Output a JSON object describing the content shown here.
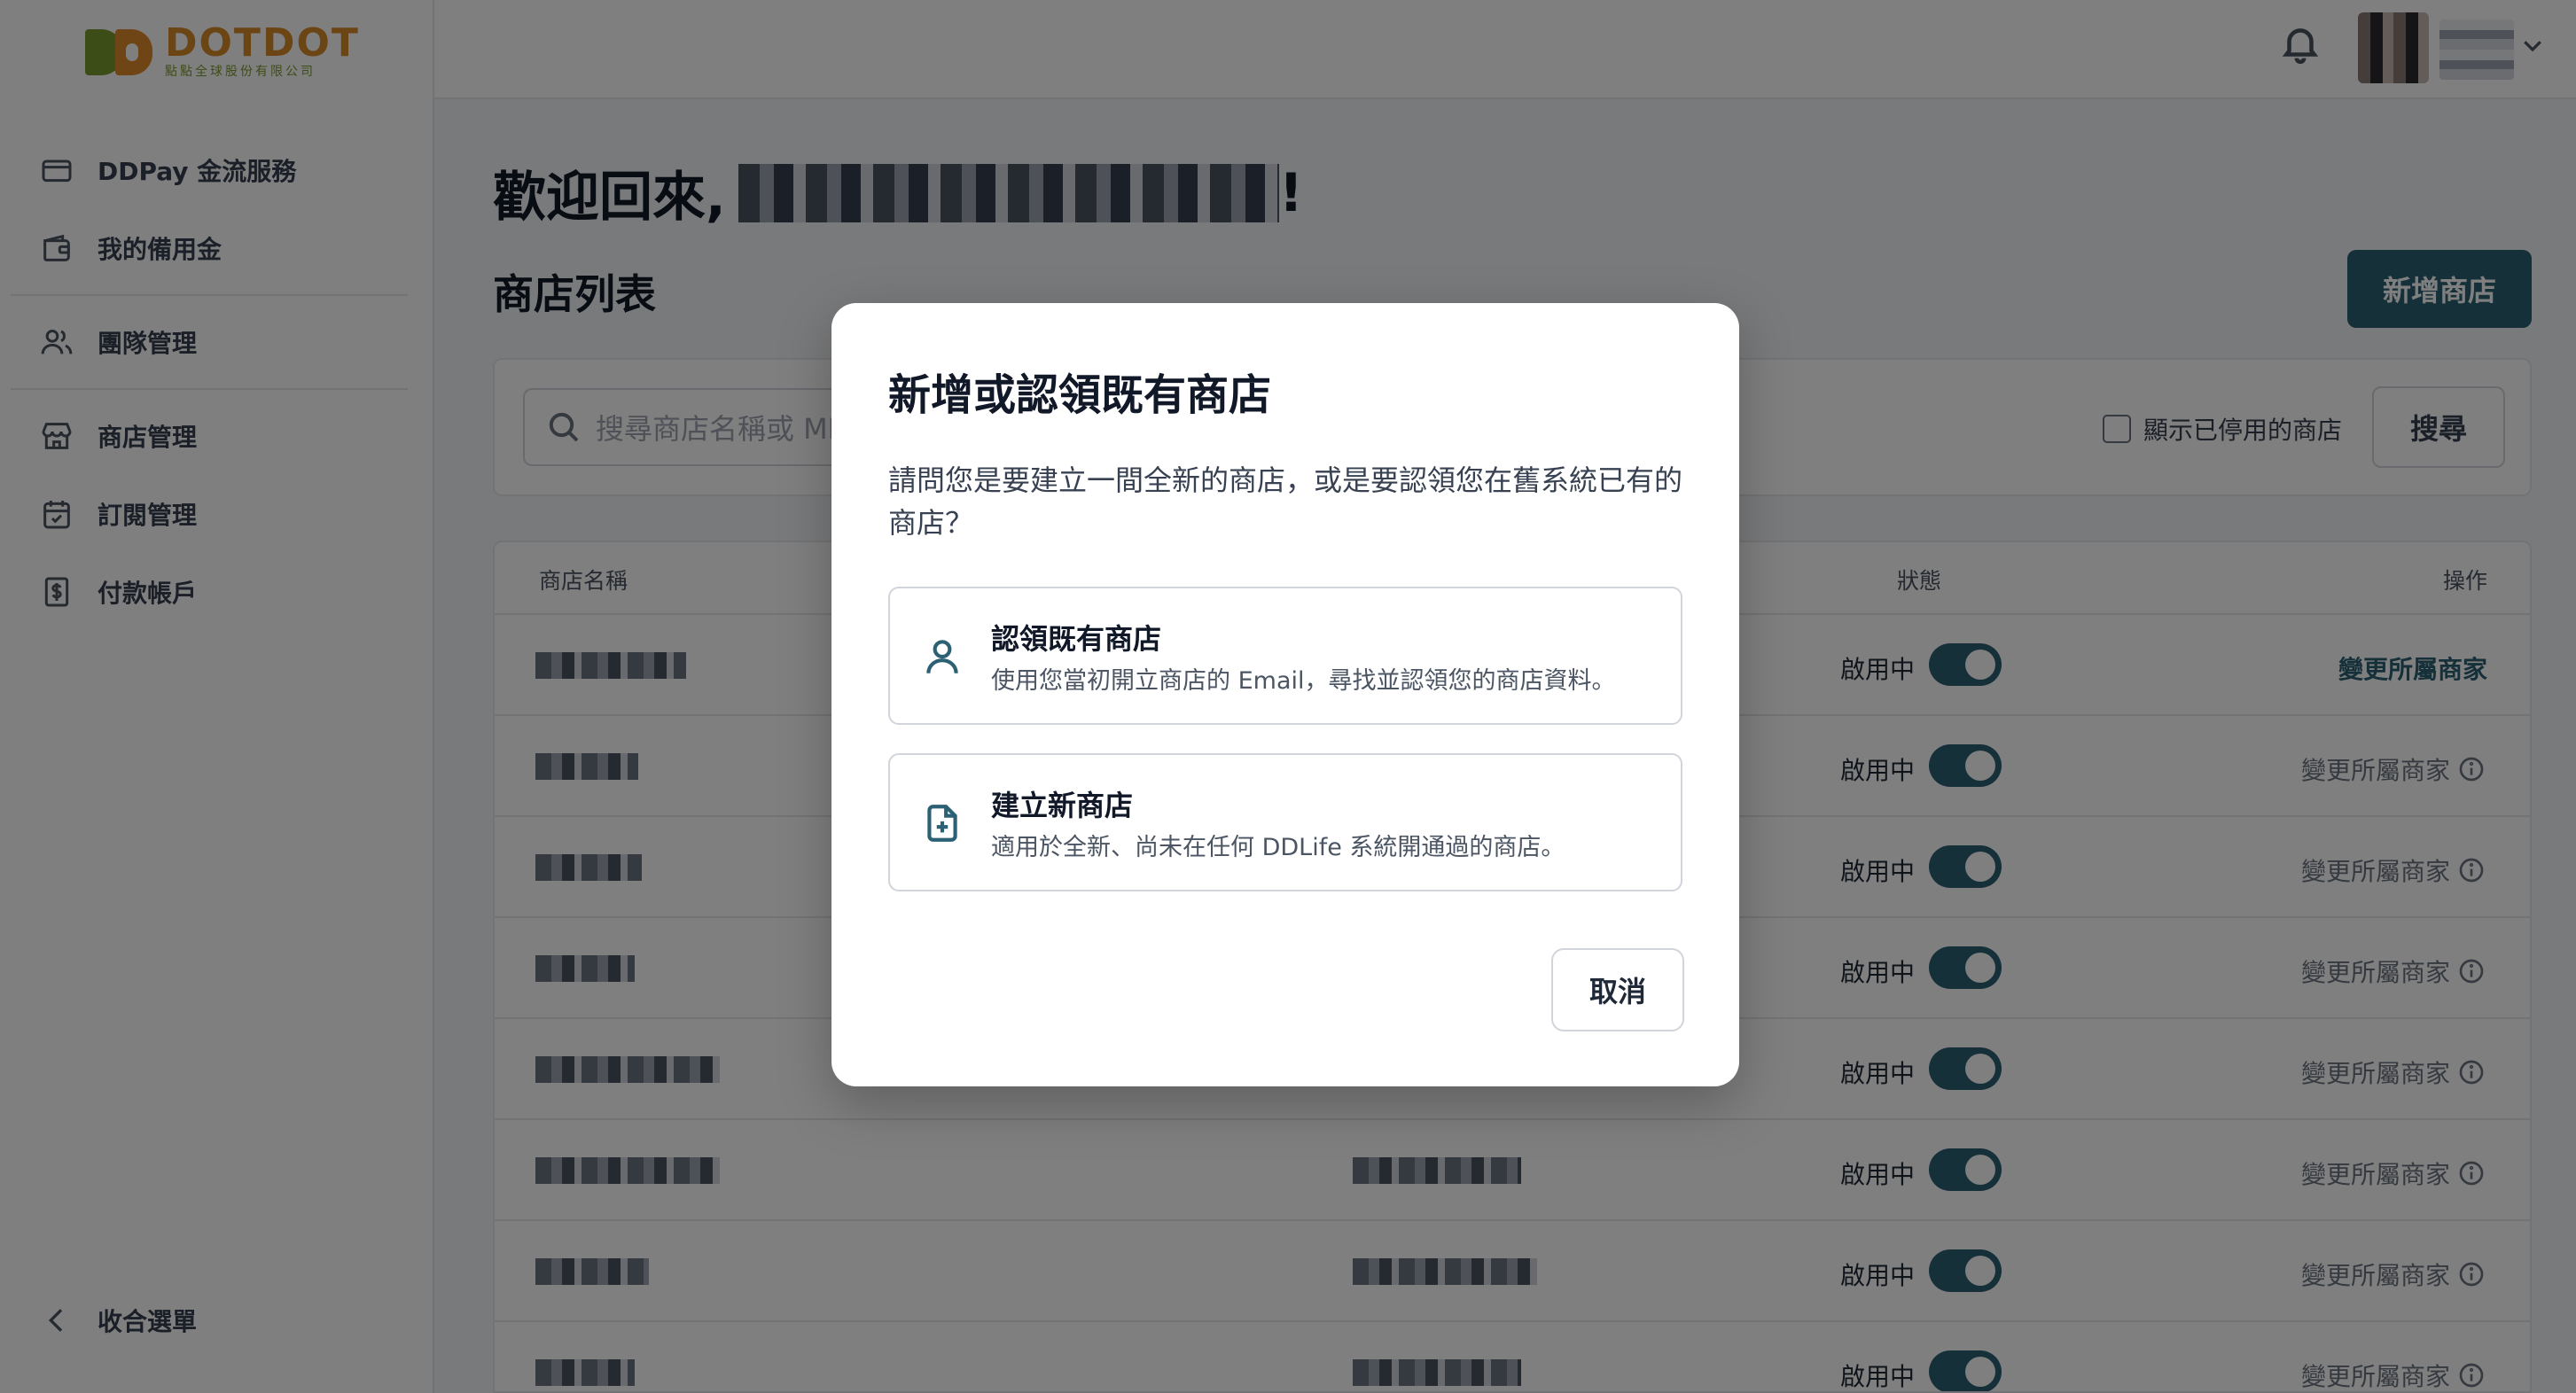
{
  "brand": {
    "name": "DOTDOT",
    "subtitle": "點點全球股份有限公司"
  },
  "sidebar": {
    "items": [
      {
        "label": "DDPay 金流服務",
        "icon": "credit-card-icon"
      },
      {
        "label": "我的備用金",
        "icon": "wallet-icon"
      },
      {
        "label": "團隊管理",
        "icon": "users-icon"
      },
      {
        "label": "商店管理",
        "icon": "store-icon"
      },
      {
        "label": "訂閱管理",
        "icon": "calendar-check-icon"
      },
      {
        "label": "付款帳戶",
        "icon": "dollar-doc-icon"
      }
    ],
    "collapse_label": "收合選單"
  },
  "header": {
    "notification_icon": "bell-icon"
  },
  "main": {
    "welcome": "歡迎回來,",
    "welcome_suffix": "!",
    "list_title": "商店列表",
    "add_store_label": "新增商店",
    "search": {
      "placeholder": "搜尋商店名稱或 MI",
      "show_disabled_label": "顯示已停用的商店",
      "show_disabled_checked": false,
      "button_label": "搜尋"
    },
    "table": {
      "headers": {
        "name": "商店名稱",
        "status": "狀態",
        "action": "操作"
      },
      "rows": [
        {
          "status": "啟用中",
          "enabled": true,
          "action": "變更所屬商家",
          "action_enabled": true
        },
        {
          "status": "啟用中",
          "enabled": true,
          "action": "變更所屬商家",
          "action_enabled": false
        },
        {
          "status": "啟用中",
          "enabled": true,
          "action": "變更所屬商家",
          "action_enabled": false
        },
        {
          "status": "啟用中",
          "enabled": true,
          "action": "變更所屬商家",
          "action_enabled": false
        },
        {
          "status": "啟用中",
          "enabled": true,
          "action": "變更所屬商家",
          "action_enabled": false
        },
        {
          "status": "啟用中",
          "enabled": true,
          "action": "變更所屬商家",
          "action_enabled": false
        },
        {
          "status": "啟用中",
          "enabled": true,
          "action": "變更所屬商家",
          "action_enabled": false
        },
        {
          "status": "啟用中",
          "enabled": true,
          "action": "變更所屬商家",
          "action_enabled": false
        }
      ]
    }
  },
  "modal": {
    "title": "新增或認領既有商店",
    "description": "請問您是要建立一間全新的商店，或是要認領您在舊系統已有的商店？",
    "options": [
      {
        "title": "認領既有商店",
        "description": "使用您當初開立商店的 Email，尋找並認領您的商店資料。",
        "icon": "user-icon"
      },
      {
        "title": "建立新商店",
        "description": "適用於全新、尚未在任何 DDLife 系統開通過的商店。",
        "icon": "file-plus-icon"
      }
    ],
    "cancel_label": "取消"
  },
  "colors": {
    "accent": "#2c6174",
    "overlay": "rgba(0,0,0,0.5)"
  }
}
